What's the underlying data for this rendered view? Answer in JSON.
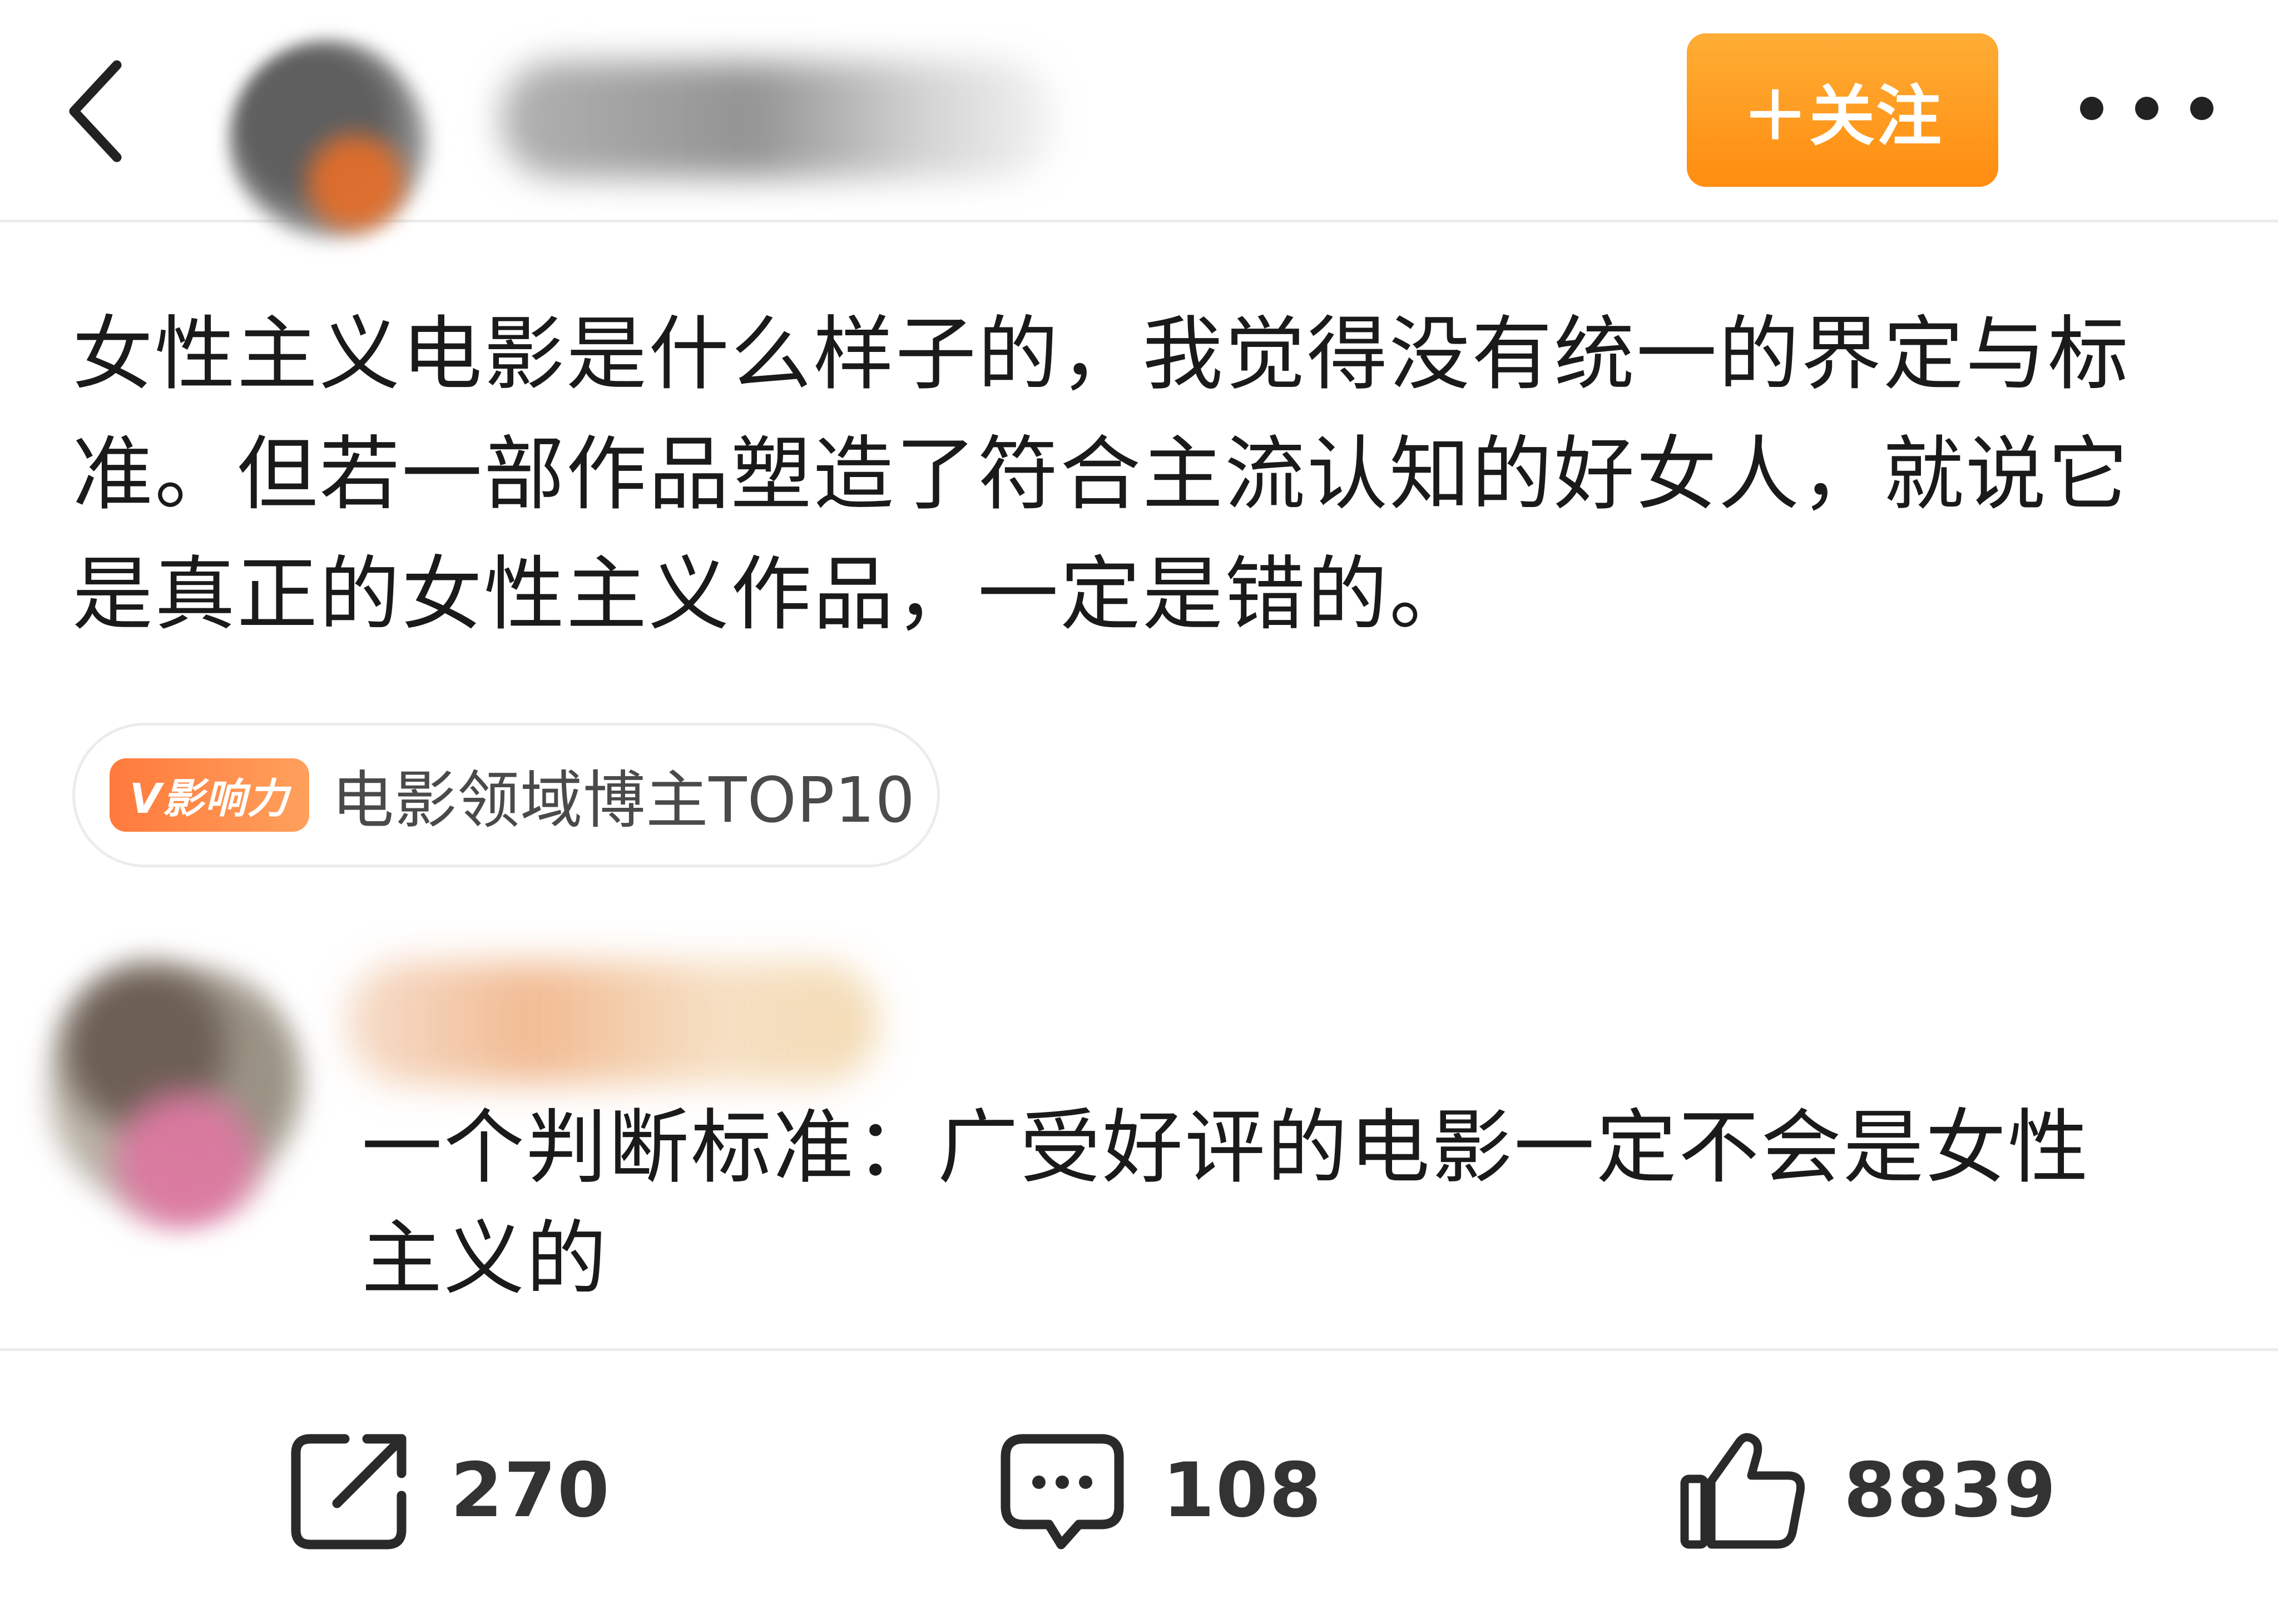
{
  "header": {
    "follow_label": "＋关注",
    "back_icon": "chevron-left-icon",
    "more_icon": "more-dots-icon"
  },
  "post": {
    "text": "女性主义电影是什么样子的，我觉得没有统一的界定与标准。但若一部作品塑造了符合主流认知的好女人，就说它是真正的女性主义作品，一定是错的。"
  },
  "badge": {
    "tag": "V影响力",
    "text": "电影领域博主TOP10"
  },
  "comment": {
    "text": "一个判断标准：广受好评的电影一定不会是女性主义的"
  },
  "actions": {
    "repost_count": "270",
    "comment_count": "108",
    "like_count": "8839"
  },
  "colors": {
    "follow_button": "#ff9a20",
    "badge_tag": "#ff8a4a",
    "text": "#1a1a1a",
    "divider": "#ececec"
  }
}
